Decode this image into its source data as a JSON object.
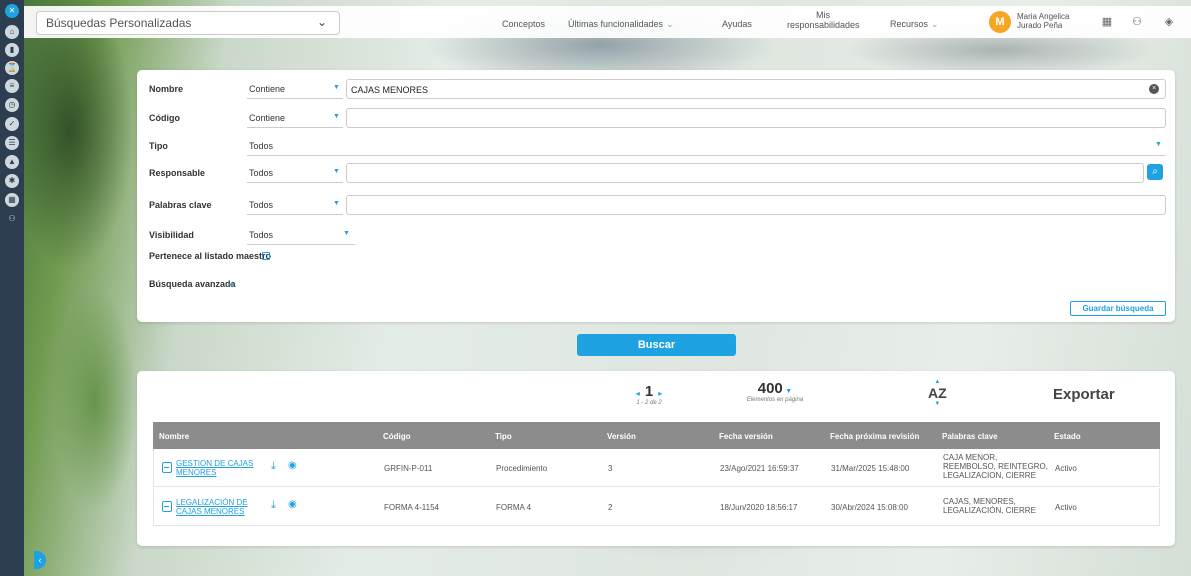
{
  "topbar": {
    "search_type": "Búsquedas Personalizadas",
    "nav": [
      {
        "label": "Conceptos",
        "dropdown": false
      },
      {
        "label": "Últimas funcionalidades",
        "dropdown": true
      },
      {
        "label": "Ayudas",
        "dropdown": false
      },
      {
        "label": "Mis responsabilidades",
        "dropdown": false
      },
      {
        "label": "Recursos",
        "dropdown": true
      }
    ],
    "user": {
      "initial": "M",
      "name_line1": "Maria Angelica",
      "name_line2": "Jurado Peña"
    }
  },
  "filters": {
    "nombre": {
      "label": "Nombre",
      "operator": "Contiene",
      "value": "CAJAS MENORES"
    },
    "codigo": {
      "label": "Código",
      "operator": "Contiene",
      "value": ""
    },
    "tipo": {
      "label": "Tipo",
      "value": "Todos"
    },
    "responsable": {
      "label": "Responsable",
      "operator": "Todos",
      "value": ""
    },
    "palabras": {
      "label": "Palabras clave",
      "operator": "Todos",
      "value": ""
    },
    "visibilidad": {
      "label": "Visibilidad",
      "value": "Todos"
    },
    "pertenece": {
      "label": "Pertenece al listado maestro",
      "checked": false
    },
    "avanzada": {
      "label": "Búsqueda avanzada"
    },
    "guardar": "Guardar búsqueda"
  },
  "buscar": "Buscar",
  "results": {
    "page": "1",
    "page_range": "1 - 2 de 2",
    "per_page": "400",
    "per_page_label": "Elementos en página",
    "sort_label": "AZ",
    "export_label": "Exportar",
    "columns": [
      "Nombre",
      "Código",
      "Tipo",
      "Versión",
      "Fecha versión",
      "Fecha próxima revisión",
      "Palabras clave",
      "Estado"
    ],
    "rows": [
      {
        "nombre": "GESTION DE CAJAS MENORES",
        "codigo": "GRFIN-P-011",
        "tipo": "Procedimiento",
        "version": "3",
        "fecha_version": "23/Ago/2021 16:59:37",
        "fecha_revision": "31/Mar/2025 15:48:00",
        "palabras": "CAJA MENOR, REEMBOLSO, REINTEGRO, LEGALIZACION, CIERRE",
        "estado": "Activo"
      },
      {
        "nombre": "LEGALIZACIÓN DE CAJAS MENORES",
        "codigo": "FORMA 4-1154",
        "tipo": "FORMA 4",
        "version": "2",
        "fecha_version": "18/Jun/2020 18:56:17",
        "fecha_revision": "30/Abr/2024 15:08:00",
        "palabras": "CAJAS, MENORES, LEGALIZACIÓN, CIERRE",
        "estado": "Activo"
      }
    ]
  },
  "colors": {
    "accent": "#1fa2e1",
    "header_gray": "#8c8c8c",
    "rail": "#2c3e50",
    "avatar": "#f5a623"
  },
  "icons": [
    "menu-icon",
    "home-icon",
    "chart-icon",
    "hourglass-icon",
    "database-icon",
    "clock-icon",
    "check-icon",
    "list-icon",
    "warning-icon",
    "settings-icon",
    "calendar-icon",
    "people-icon"
  ]
}
